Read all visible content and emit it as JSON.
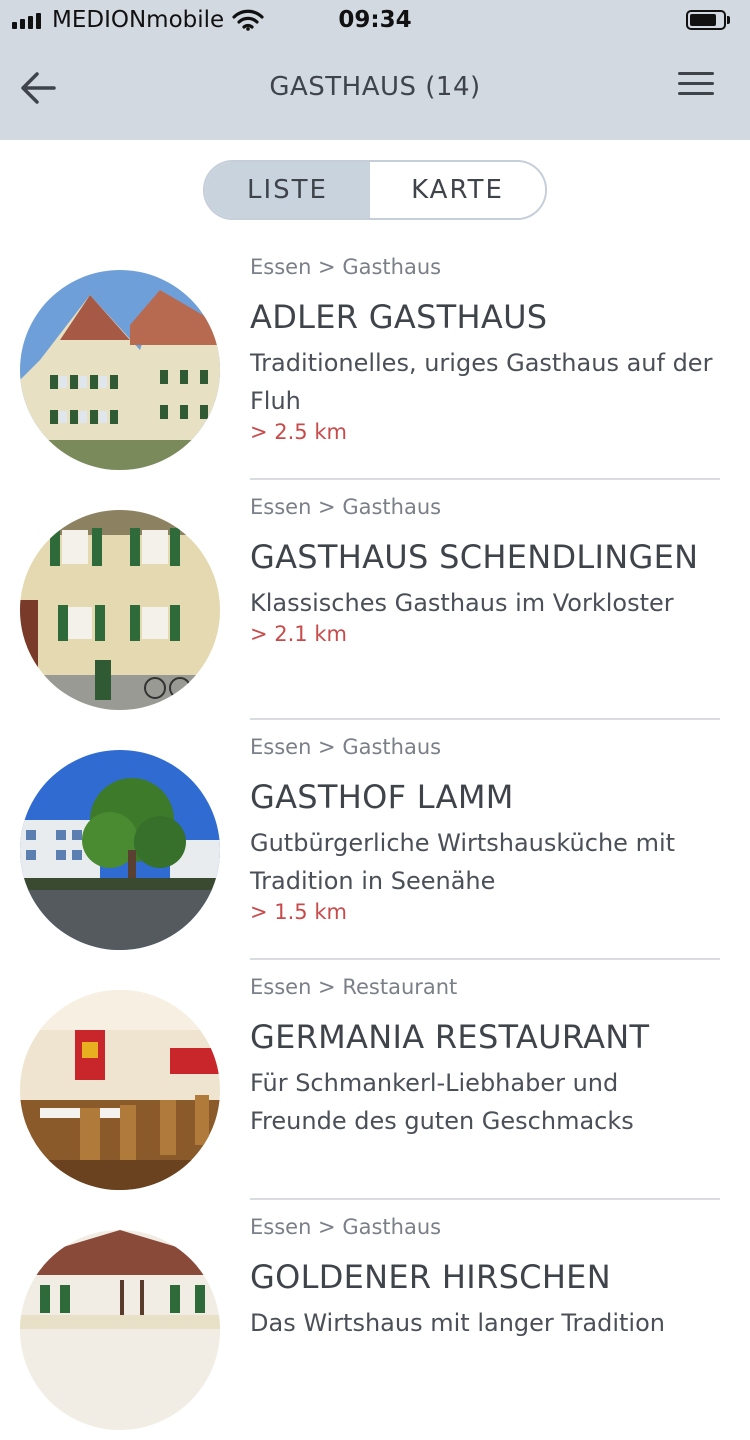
{
  "status_bar": {
    "carrier": "MEDIONmobile",
    "time": "09:34"
  },
  "header": {
    "title": "GASTHAUS (14)"
  },
  "view_toggle": {
    "list_label": "LISTE",
    "map_label": "KARTE",
    "selected": "LISTE"
  },
  "colors": {
    "bar_background": "#d3d9e1",
    "toggle_active": "#c9d3de",
    "distance": "#c84a4a",
    "text": "#3f444b"
  },
  "items": [
    {
      "category": "Essen > Gasthaus",
      "title": "ADLER GASTHAUS",
      "description": "Traditionelles, uriges Gasthaus auf der Fluh",
      "distance": "> 2.5 km"
    },
    {
      "category": "Essen > Gasthaus",
      "title": "GASTHAUS SCHENDLINGEN",
      "description": "Klassisches Gasthaus im Vorkloster",
      "distance": "> 2.1 km"
    },
    {
      "category": "Essen > Gasthaus",
      "title": "GASTHOF LAMM",
      "description": "Gutbürgerliche Wirtshausküche mit Tradition in Seenähe",
      "distance": "> 1.5 km"
    },
    {
      "category": "Essen > Restaurant",
      "title": "GERMANIA RESTAURANT",
      "description": "Für Schmankerl-Liebhaber und Freunde des guten Geschmacks"
    },
    {
      "category": "Essen > Gasthaus",
      "title": "GOLDENER HIRSCHEN",
      "description": "Das Wirtshaus mit langer Tradition"
    }
  ]
}
